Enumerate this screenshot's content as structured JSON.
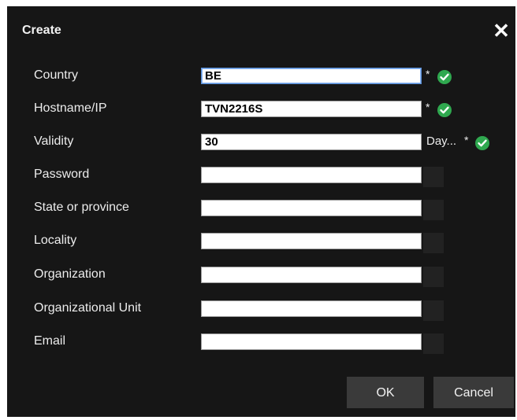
{
  "dialog": {
    "title": "Create",
    "close_icon": "close-icon"
  },
  "fields": [
    {
      "label": "Country",
      "value": "BE",
      "required_mark": "*",
      "valid": true
    },
    {
      "label": "Hostname/IP",
      "value": "TVN2216S",
      "required_mark": "*",
      "valid": true
    },
    {
      "label": "Validity",
      "value": "30",
      "suffix": "Day...",
      "required_mark": "*",
      "valid": true
    },
    {
      "label": "Password",
      "value": ""
    },
    {
      "label": "State or province",
      "value": ""
    },
    {
      "label": "Locality",
      "value": ""
    },
    {
      "label": "Organization",
      "value": ""
    },
    {
      "label": "Organizational Unit",
      "value": ""
    },
    {
      "label": "Email",
      "value": ""
    }
  ],
  "buttons": {
    "ok_label": "OK",
    "cancel_label": "Cancel"
  },
  "colors": {
    "dialog_bg": "#161616",
    "valid_check": "#2fa84f",
    "button_bg": "#3a3a3a"
  }
}
